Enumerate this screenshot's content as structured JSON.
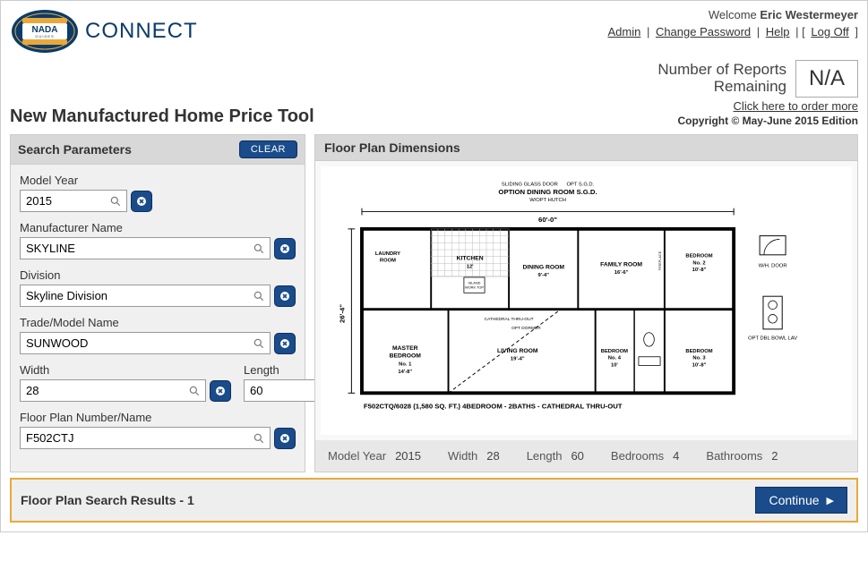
{
  "header": {
    "brand_name_small1": "NADA",
    "brand_name_small2": "GUIDES",
    "brand_connect": "CONNECT",
    "welcome_prefix": "Welcome ",
    "user_name": "Eric Westermeyer",
    "links": {
      "admin": "Admin",
      "change_password": "Change Password",
      "help": "Help",
      "logoff": "Log Off"
    },
    "reports_label_line1": "Number of Reports",
    "reports_label_line2": "Remaining",
    "reports_value": "N/A",
    "order_more": "Click here to order more",
    "copyright": "Copyright © May-June 2015 Edition"
  },
  "page_title": "New Manufactured Home Price Tool",
  "sidebar": {
    "title": "Search Parameters",
    "clear_label": "CLEAR",
    "fields": {
      "model_year": {
        "label": "Model Year",
        "value": "2015"
      },
      "manufacturer": {
        "label": "Manufacturer Name",
        "value": "SKYLINE"
      },
      "division": {
        "label": "Division",
        "value": "Skyline Division"
      },
      "trade_model": {
        "label": "Trade/Model Name",
        "value": "SUNWOOD"
      },
      "width": {
        "label": "Width",
        "value": "28"
      },
      "length": {
        "label": "Length",
        "value": "60"
      },
      "floor_plan": {
        "label": "Floor Plan Number/Name",
        "value": "F502CTJ"
      }
    }
  },
  "content": {
    "title": "Floor Plan Dimensions",
    "floorplan_caption": "F502CTQ/6028 (1,580 SQ. FT.) 4BEDROOM - 2BATHS - CATHEDRAL THRU-OUT",
    "option_title": "OPTION DINING ROOM S.G.D.",
    "overall_width": "60'-0\"",
    "overall_depth": "26'-4\"",
    "rooms": {
      "laundry": "LAUNDRY ROOM",
      "kitchen": "KITCHEN",
      "kitchen_dim": "12'",
      "dining": "DINING ROOM",
      "dining_dim": "9'-4\"",
      "family": "FAMILY ROOM",
      "family_dim": "16'-6\"",
      "bed2": "BEDROOM No. 2",
      "bed2_dim": "10'-8\"",
      "master": "MASTER BEDROOM No. 1",
      "master_dim": "14'-8\"",
      "living": "LIVING ROOM",
      "living_dim": "19'-4\"",
      "bed4": "BEDROOM No. 4",
      "bed4_dim": "10'",
      "bed3": "BEDROOM No. 3",
      "bed3_dim": "10'-8\""
    },
    "legend": {
      "wh_door": "W/H. DOOR",
      "opt_lav": "OPT DBL BOWL LAV"
    },
    "stats": {
      "my_label": "Model Year",
      "my_val": "2015",
      "w_label": "Width",
      "w_val": "28",
      "l_label": "Length",
      "l_val": "60",
      "bed_label": "Bedrooms",
      "bed_val": "4",
      "bath_label": "Bathrooms",
      "bath_val": "2"
    }
  },
  "footer": {
    "results_label": "Floor Plan Search Results - 1",
    "continue_label": "Continue"
  }
}
